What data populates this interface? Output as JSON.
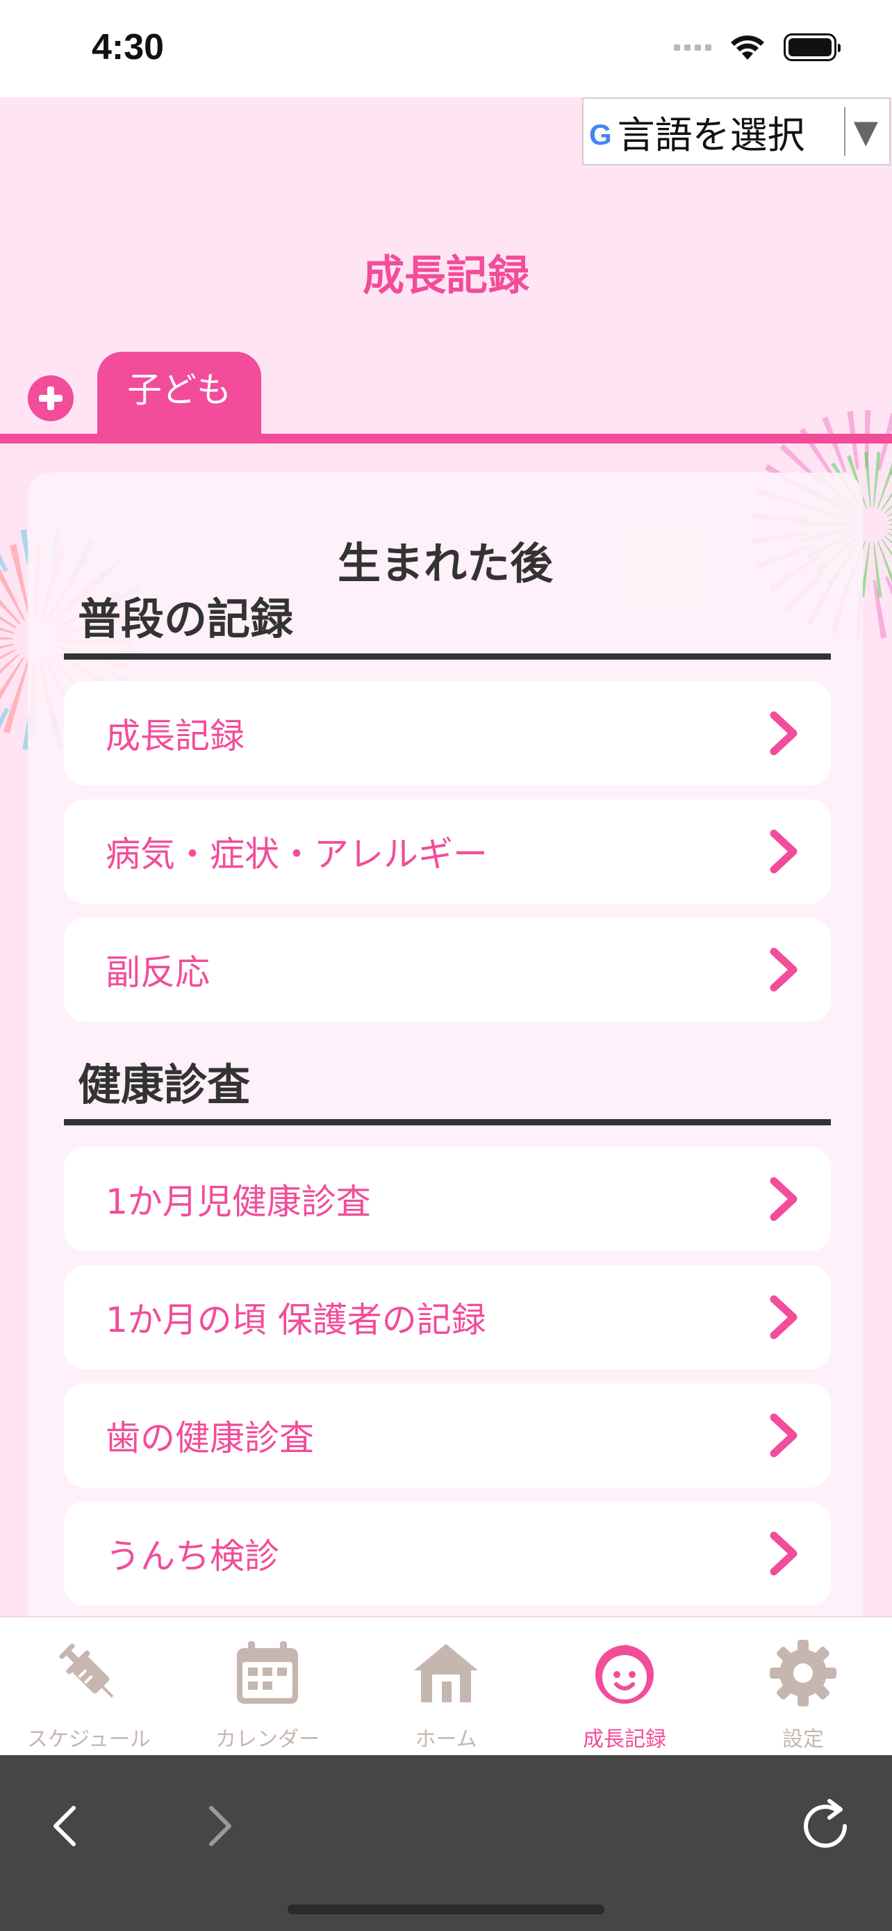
{
  "status_bar": {
    "time": "4:30"
  },
  "language_selector": {
    "brand_mark": "G",
    "label": "言語を選択",
    "arrow": "▼"
  },
  "header": {
    "title": "成長記録"
  },
  "child_tabs": {
    "add_icon": "plus-circle-icon",
    "tabs": [
      {
        "label": "子ども",
        "selected": true
      }
    ]
  },
  "card": {
    "title": "生まれた後",
    "sections": [
      {
        "title": "普段の記録",
        "items": [
          {
            "label": "成長記録"
          },
          {
            "label": "病気・症状・アレルギー"
          },
          {
            "label": "副反応"
          }
        ]
      },
      {
        "title": "健康診査",
        "items": [
          {
            "label": "1か月児健康診査"
          },
          {
            "label": "1か月の頃 保護者の記録"
          },
          {
            "label": "歯の健康診査"
          },
          {
            "label": "うんち検診"
          }
        ]
      }
    ]
  },
  "tab_bar": {
    "tabs": [
      {
        "label": "スケジュール",
        "icon": "syringe-icon"
      },
      {
        "label": "カレンダー",
        "icon": "calendar-icon"
      },
      {
        "label": "ホーム",
        "icon": "house-icon"
      },
      {
        "label": "成長記録",
        "icon": "baby-face-icon",
        "active": true
      },
      {
        "label": "設定",
        "icon": "gear-icon"
      }
    ]
  },
  "colors": {
    "accent": "#f24c9a",
    "background": "#ffe4f3",
    "inactive_tab": "#c6b6b0",
    "browser_bar": "#464646"
  }
}
